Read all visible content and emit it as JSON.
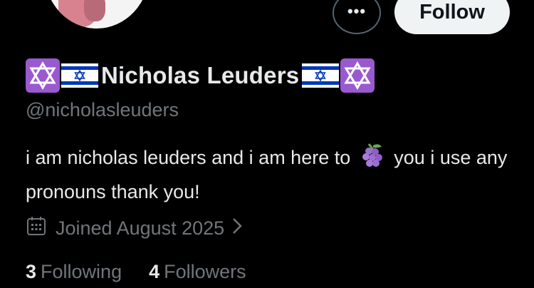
{
  "header": {
    "follow_label": "Follow",
    "more_label": "•••"
  },
  "profile": {
    "display_name": "Nicholas Leuders",
    "name_emojis": [
      "star-of-david",
      "israel-flag",
      "israel-flag",
      "star-of-david"
    ],
    "handle": "@nicholasleuders",
    "bio_part1": "i am nicholas leuders and i am here to",
    "bio_emoji": "grapes",
    "bio_part2": "you i use any pronouns thank you!",
    "joined": "Joined August 2025"
  },
  "stats": {
    "following_count": "3",
    "following_label": "Following",
    "followers_count": "4",
    "followers_label": "Followers"
  },
  "colors": {
    "background": "#000000",
    "text_primary": "#e7e9ea",
    "text_secondary": "#71767b",
    "follow_button_bg": "#eff3f4",
    "star_box": "#9b59d0",
    "flag_blue": "#0038b8"
  }
}
